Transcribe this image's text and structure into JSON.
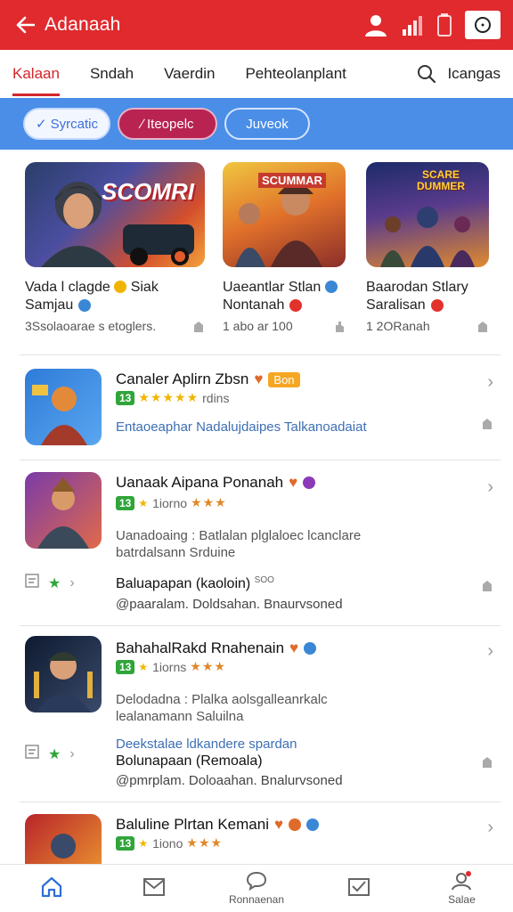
{
  "header": {
    "title": "Adanaah",
    "signal_text": "",
    "colors": {
      "brand": "#e02a2e"
    }
  },
  "tabs": [
    {
      "label": "Kalaan",
      "active": true
    },
    {
      "label": "Sndah"
    },
    {
      "label": "Vaerdin"
    },
    {
      "label": "Pehteolanplant"
    }
  ],
  "tab_search_label": "Icangas",
  "chips": [
    {
      "label": "Syrcatic"
    },
    {
      "label": "Iteopelc"
    },
    {
      "label": "Juveok"
    }
  ],
  "featured": [
    {
      "banner": "SCOMRI",
      "name": "Vada l clagde",
      "name_suffix": "Siak",
      "sub": "Samjau",
      "meta": "3Ssolaoarae s etoglers."
    },
    {
      "banner": "SCUMMAR",
      "name": "Uaeantlar Stlan",
      "sub": "Nontanah",
      "meta": "1 abo ar 100"
    },
    {
      "banner": "SCARE DUMMER",
      "name": "Baarodan Stlary",
      "sub": "Saralisan",
      "meta": "1 2ORanah"
    }
  ],
  "apps": [
    {
      "name": "Canaler Aplirn Zbsn",
      "tag": "Bon",
      "age": "13",
      "rating_text": "rdins",
      "desc_line": "Entaoeaphar Nadalujdaipes Talkanoadaiat"
    },
    {
      "name": "Uanaak Aipana Ponanah",
      "age": "13",
      "rating_text": "1iorno",
      "desc_lines": [
        "Uanadoaing : Batlalan plglaloec lcanclare",
        "batrdalsann Srduine"
      ],
      "review_title": "Baluapapan (kaoloin)",
      "review_title_suffix": "SOO",
      "review_sub": "@paaralam. Doldsahan. Bnaurvsoned"
    },
    {
      "name": "BahahalRakd Rnahenain",
      "age": "13",
      "rating_text": "1iorns",
      "desc_lines": [
        "Delodadna : Plalka aolsgalleanrkalc",
        "lealanamann Saluilna"
      ],
      "review_link": "Deekstalae ldkandere spardan",
      "review_title": "Bolunapaan (Remoala)",
      "review_sub": "@pmrplam. Doloaahan. Bnalurvsoned"
    },
    {
      "name": "Baluline Plrtan Kemani",
      "age": "13",
      "rating_text": "1iono"
    }
  ],
  "bottom_nav": [
    {
      "label": "",
      "icon": "home-icon",
      "active": true
    },
    {
      "label": "",
      "icon": "mail-icon"
    },
    {
      "label": "Ronnaenan",
      "icon": "chat-icon"
    },
    {
      "label": "",
      "icon": "inbox-icon"
    },
    {
      "label": "Salae",
      "icon": "profile-icon"
    }
  ]
}
